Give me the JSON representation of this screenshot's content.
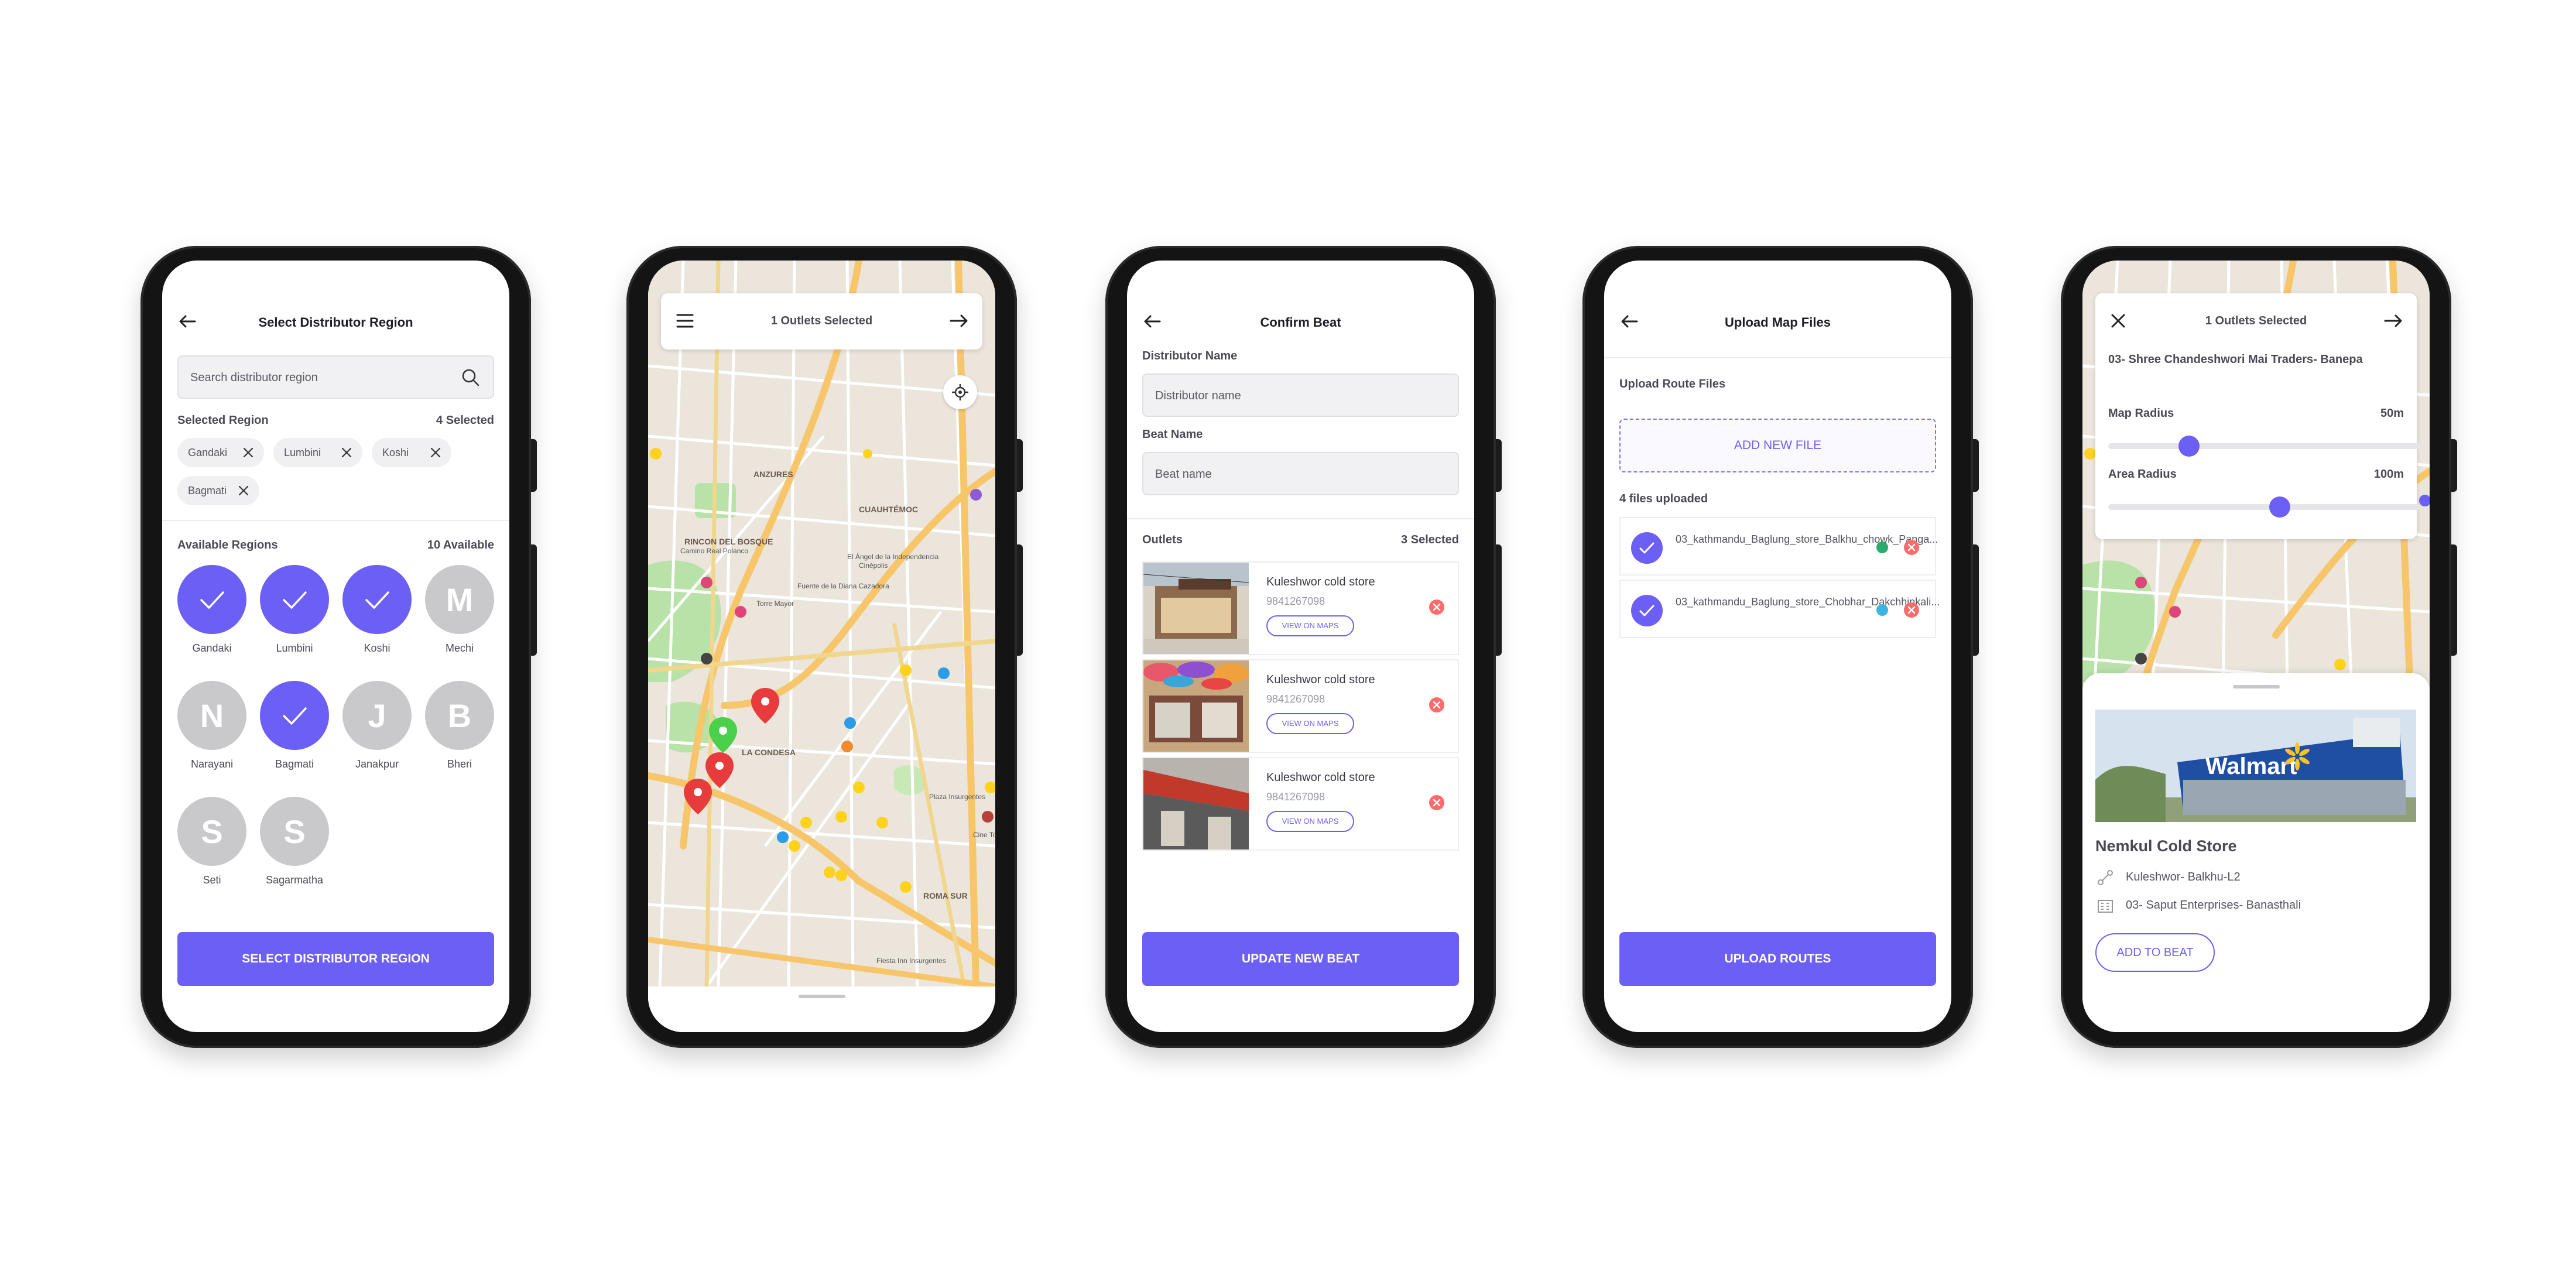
{
  "colors": {
    "accent": "#6c5ff5",
    "danger": "#e84545",
    "pin_green": "#4ad04a",
    "pin_red": "#e83b3b",
    "pin_yellow": "#ffd21e",
    "pin_blue": "#2d9be6"
  },
  "screen1": {
    "title": "Select Distributor Region",
    "search_placeholder": "Search distributor region",
    "selected_label": "Selected Region",
    "selected_count": "4 Selected",
    "chips": [
      "Gandaki",
      "Lumbini",
      "Koshi",
      "Bagmati"
    ],
    "available_label": "Available Regions",
    "available_count": "10 Available",
    "regions": [
      {
        "name": "Gandaki",
        "letter": "",
        "selected": true
      },
      {
        "name": "Lumbini",
        "letter": "",
        "selected": true
      },
      {
        "name": "Koshi",
        "letter": "",
        "selected": true
      },
      {
        "name": "Mechi",
        "letter": "M",
        "selected": false
      },
      {
        "name": "Narayani",
        "letter": "N",
        "selected": false
      },
      {
        "name": "Bagmati",
        "letter": "",
        "selected": true
      },
      {
        "name": "Janakpur",
        "letter": "J",
        "selected": false
      },
      {
        "name": "Bheri",
        "letter": "B",
        "selected": false
      },
      {
        "name": "Seti",
        "letter": "S",
        "selected": false
      },
      {
        "name": "Sagarmatha",
        "letter": "S",
        "selected": false
      }
    ],
    "button": "SELECT DISTRIBUTOR REGION"
  },
  "screen2": {
    "title": "1 Outlets Selected",
    "map_labels": [
      "RINCON DEL BOSQUE",
      "ANZURES",
      "CUAUHTÉMOC",
      "LA CONDESA",
      "ROMA SUR",
      "Camino Real Polanco",
      "Torre Mayor",
      "El Ángel de la Independencia",
      "Fuente de la Diana Cazadora",
      "Plaza Insurgentes",
      "Cine Tonalá",
      "Cinépolis",
      "Fiesta Inn Insurgentes"
    ]
  },
  "screen3": {
    "title": "Confirm Beat",
    "distributor_label": "Distributor Name",
    "distributor_placeholder": "Distributor name",
    "beat_label": "Beat Name",
    "beat_placeholder": "Beat name",
    "outlets_label": "Outlets",
    "outlets_count": "3 Selected",
    "outlets": [
      {
        "name": "Kuleshwor cold store",
        "phone": "9841267098",
        "map_btn": "VIEW ON MAPS"
      },
      {
        "name": "Kuleshwor cold store",
        "phone": "9841267098",
        "map_btn": "VIEW ON MAPS"
      },
      {
        "name": "Kuleshwor cold store",
        "phone": "9841267098",
        "map_btn": "VIEW ON MAPS"
      }
    ],
    "button": "UPDATE NEW BEAT"
  },
  "screen4": {
    "title": "Upload Map Files",
    "upload_label": "Upload Route Files",
    "add_file": "ADD NEW FILE",
    "uploaded_label": "4 files uploaded",
    "files": [
      {
        "name": "03_kathmandu_Baglung_store_Balkhu_chowk_Panga...",
        "dot": "#2daa6e"
      },
      {
        "name": "03_kathmandu_Baglung_store_Chobhar_Dakchhinkali...",
        "dot": "#3cb6e0"
      }
    ],
    "button": "UPLOAD ROUTES"
  },
  "screen5": {
    "title": "1 Outlets Selected",
    "store_heading": "03- Shree Chandeshwori Mai Traders- Banepa",
    "map_radius_label": "Map Radius",
    "map_radius_value": "50m",
    "map_radius_fraction": 0.26,
    "area_radius_label": "Area Radius",
    "area_radius_value": "100m",
    "area_radius_fraction": 0.55,
    "sign_text": "Walmart",
    "outlet_name": "Nemkul Cold Store",
    "route": "Kuleshwor- Balkhu-L2",
    "distributor": "03- Saput Enterprises- Banasthali",
    "button": "ADD TO BEAT"
  }
}
